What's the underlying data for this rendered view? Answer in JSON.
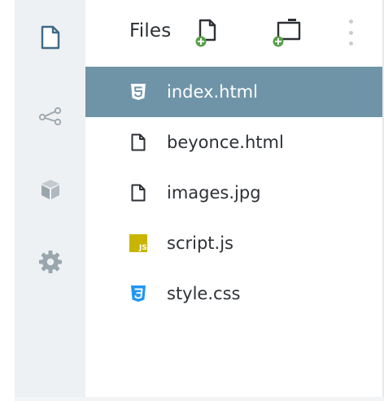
{
  "header": {
    "title": "Files",
    "new_file_icon": "new-file-icon",
    "new_folder_icon": "new-folder-icon",
    "menu_icon": "kebab-menu-icon"
  },
  "sidebar": {
    "items": [
      {
        "icon": "file-icon",
        "active": true
      },
      {
        "icon": "share-icon",
        "active": false
      },
      {
        "icon": "package-icon",
        "active": false
      },
      {
        "icon": "gear-icon",
        "active": false
      }
    ]
  },
  "files": [
    {
      "name": "index.html",
      "icon": "html5-icon",
      "selected": true
    },
    {
      "name": "beyonce.html",
      "icon": "file-icon",
      "selected": false
    },
    {
      "name": "images.jpg",
      "icon": "file-icon",
      "selected": false
    },
    {
      "name": "script.js",
      "icon": "js-icon",
      "selected": false
    },
    {
      "name": "style.css",
      "icon": "css3-icon",
      "selected": false
    }
  ],
  "colors": {
    "selected_row": "#6f94a8",
    "rail_bg": "#eef1f3",
    "green_plus": "#5aa04a",
    "html_badge": "#ffffff",
    "js_badge": "#c9b400",
    "css_badge": "#2196f3"
  },
  "labels": {
    "js_badge_text": "JS"
  }
}
